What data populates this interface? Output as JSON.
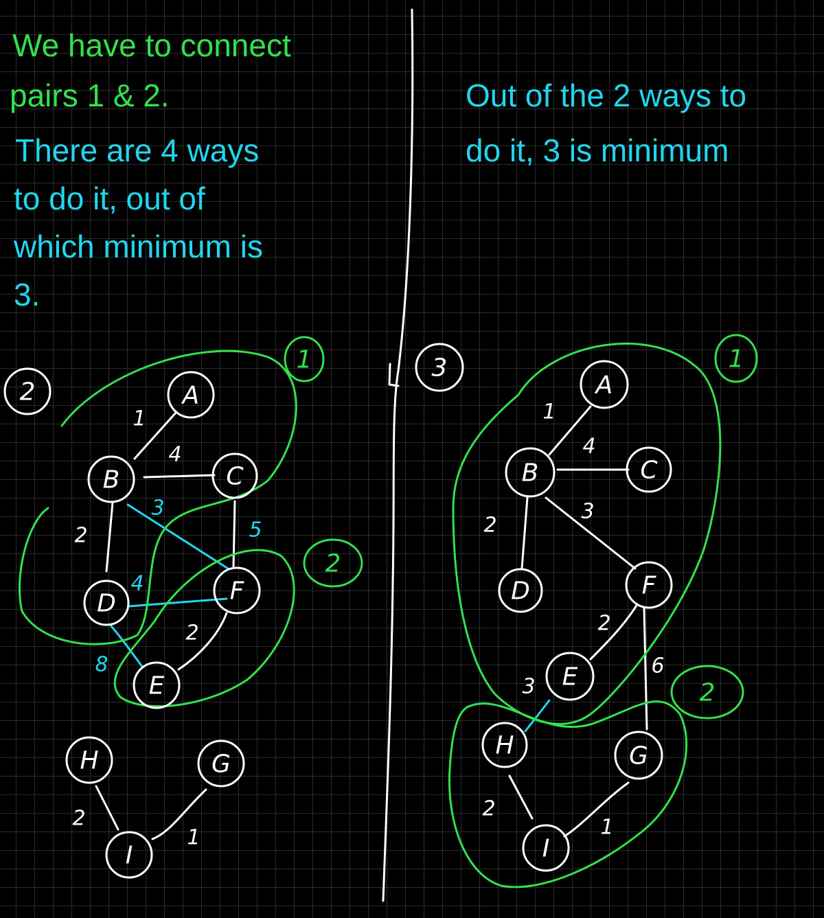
{
  "colors": {
    "background": "#000000",
    "grid": "#2c2c2c",
    "green_text": "#33e14d",
    "cyan_text": "#22d6ee",
    "ink_white": "#ffffff",
    "ink_green": "#33e14d",
    "ink_cyan": "#22d6ee"
  },
  "left_panel": {
    "note_line1": "We have to connect",
    "note_line2": "pairs 1 & 2.",
    "note_line3": "There are 4 ways",
    "note_line4": "to do it, out of",
    "note_line5": "which minimum is",
    "note_line6": "3.",
    "case_label": "2",
    "group_labels": [
      "1",
      "2"
    ],
    "nodes": [
      "A",
      "B",
      "C",
      "D",
      "F",
      "E",
      "H",
      "G",
      "I"
    ],
    "edge_weights": [
      "1",
      "4",
      "3",
      "5",
      "2",
      "4",
      "2",
      "8",
      "2",
      "1"
    ]
  },
  "right_panel": {
    "note_line1": "Out of the 2 ways to",
    "note_line2": "do it, 3 is minimum",
    "case_label": "3",
    "group_labels": [
      "1",
      "2"
    ],
    "nodes": [
      "A",
      "B",
      "C",
      "D",
      "F",
      "E",
      "H",
      "G",
      "I"
    ],
    "edge_weights": [
      "1",
      "4",
      "2",
      "3",
      "2",
      "6",
      "3",
      "2",
      "1"
    ]
  }
}
